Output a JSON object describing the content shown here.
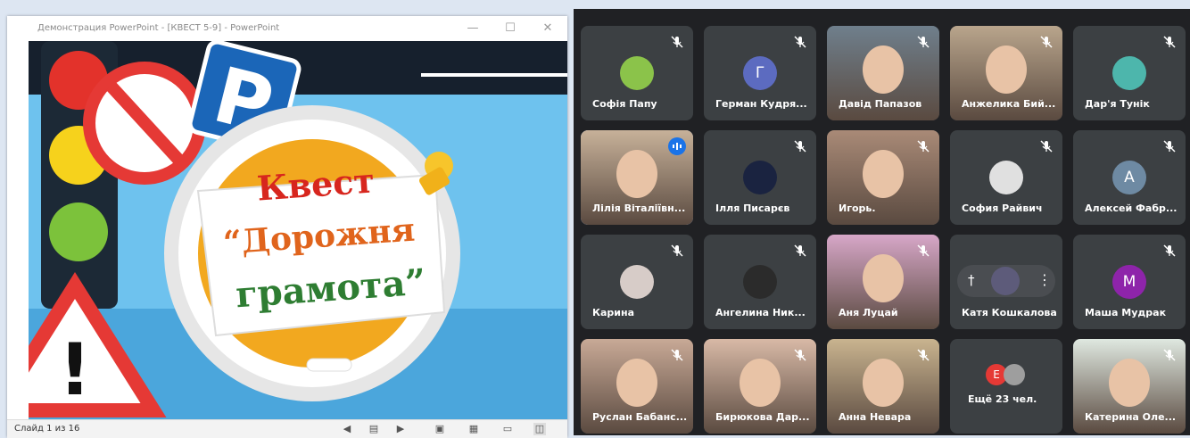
{
  "ppt": {
    "window_title": "Демонстрация PowerPoint - [КВЕСТ 5-9] - PowerPoint",
    "slide_status": "Слайд 1 из 16",
    "slide": {
      "line1": "Квест",
      "line2": "“Дорожня",
      "line3": "грамота”"
    }
  },
  "meet": {
    "participants": [
      {
        "name": "Софія Папу",
        "kind": "avatar-img",
        "color": "#8bc34a"
      },
      {
        "name": "Герман Кудря...",
        "kind": "letter",
        "letter": "Г",
        "color": "#5c6bc0"
      },
      {
        "name": "Давід Папазов",
        "kind": "video",
        "color": "#6f7f8c"
      },
      {
        "name": "Анжелика Бий...",
        "kind": "video",
        "color": "#b9a58c"
      },
      {
        "name": "Дар'я Тунік",
        "kind": "avatar-img",
        "color": "#4db6ac"
      },
      {
        "name": "Лілія Віталіївн...",
        "kind": "video",
        "color": "#c7b199",
        "speaking": true
      },
      {
        "name": "Ілля Писарєв",
        "kind": "avatar-img",
        "color": "#1a2340"
      },
      {
        "name": "Игорь.",
        "kind": "video",
        "color": "#a98a77"
      },
      {
        "name": "София Райвич",
        "kind": "avatar-img",
        "color": "#e0e0e0"
      },
      {
        "name": "Алексей Фабр...",
        "kind": "letter",
        "letter": "А",
        "color": "#6e8aa3"
      },
      {
        "name": "Карина",
        "kind": "avatar-img",
        "color": "#d7ccc8"
      },
      {
        "name": "Ангелина Ник...",
        "kind": "avatar-img",
        "color": "#2b2b2b"
      },
      {
        "name": "Аня Луцай",
        "kind": "video",
        "color": "#d7a7c8"
      },
      {
        "name": "Катя Кошкалова",
        "kind": "pinned",
        "color": "#5d5b7a"
      },
      {
        "name": "Маша Мудрак",
        "kind": "letter",
        "letter": "М",
        "color": "#8e24aa"
      },
      {
        "name": "Руслан Бабанс...",
        "kind": "video",
        "color": "#c8a996"
      },
      {
        "name": "Бирюкова Дар...",
        "kind": "video",
        "color": "#d8b9a6"
      },
      {
        "name": "Анна Невара",
        "kind": "video",
        "color": "#c9b48f"
      },
      {
        "name": "Ещё 23 чел.",
        "kind": "more",
        "letter": "Е",
        "color": "#e53935"
      },
      {
        "name": "Катерина Оле...",
        "kind": "video",
        "color": "#dfe8e0"
      }
    ]
  }
}
